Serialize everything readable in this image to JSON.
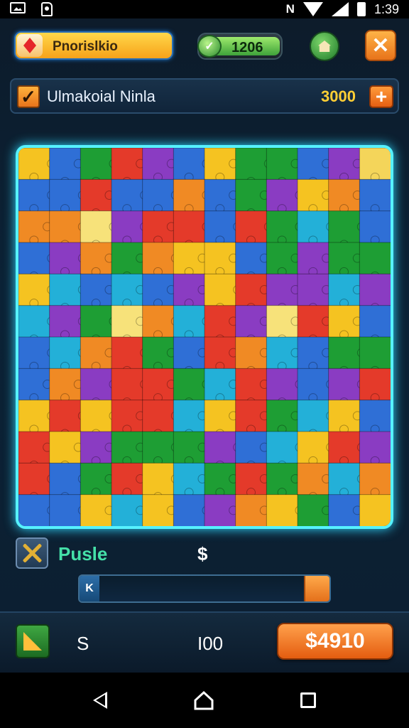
{
  "status_bar": {
    "time": "1:39",
    "icons": [
      "image-icon",
      "sd-card-icon",
      "nfc-icon",
      "wifi-icon",
      "signal-icon",
      "battery-icon"
    ]
  },
  "top_bar": {
    "title": "Pnorislkio",
    "coins": "1206",
    "home_icon": "home-icon",
    "close_icon": "close-icon"
  },
  "level_bar": {
    "name": "Ulmakoial Ninla",
    "coins": "3000",
    "plus_label": "+"
  },
  "board": {
    "palette": [
      "#1e9e34",
      "#2f6fd6",
      "#e43a2a",
      "#f5c321",
      "#8a3cc2",
      "#f08a24",
      "#23b0d8"
    ],
    "highlight_colors": [
      "#f7e27a",
      "#f4d55a"
    ],
    "border_color": "#56f2ff"
  },
  "controls": {
    "puzzle_label": "Pusle",
    "currency_symbol": "$",
    "progress_label": "K"
  },
  "footer": {
    "s_label": "S",
    "count": "I00",
    "buy_label": "$4910"
  }
}
